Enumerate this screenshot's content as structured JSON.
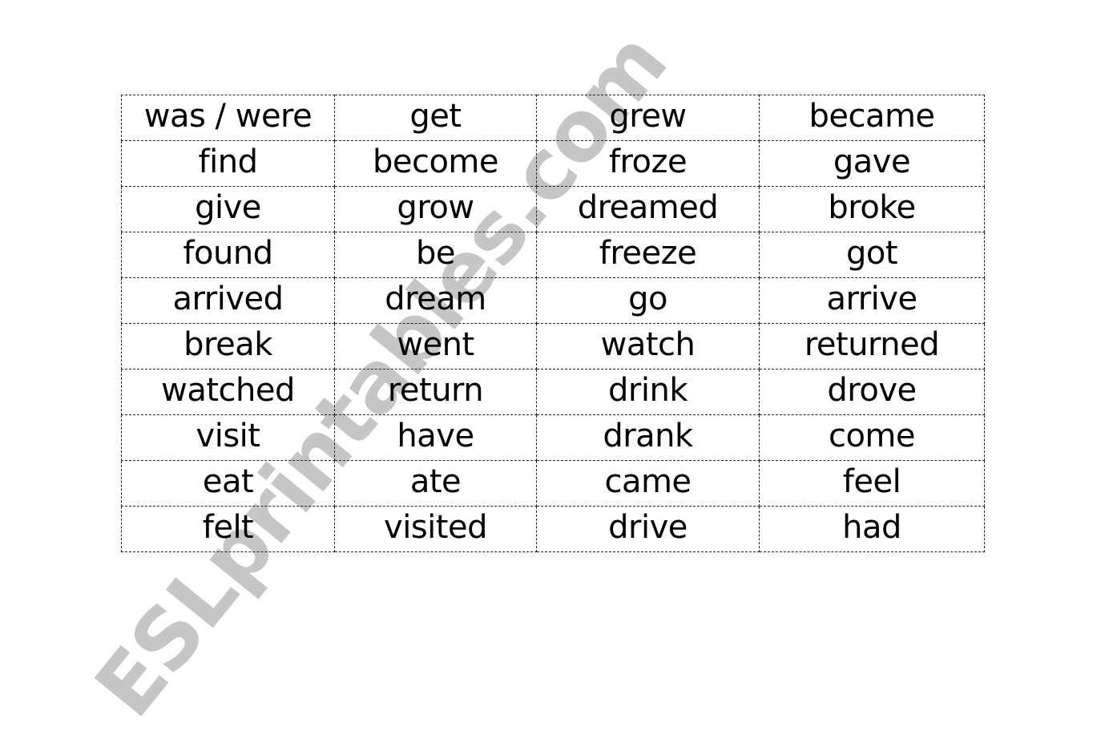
{
  "watermark": "ESLprintables.com",
  "table": {
    "rows": [
      [
        "was / were",
        "get",
        "grew",
        "became"
      ],
      [
        "find",
        "become",
        "froze",
        "gave"
      ],
      [
        "give",
        "grow",
        "dreamed",
        "broke"
      ],
      [
        "found",
        "be",
        "freeze",
        "got"
      ],
      [
        "arrived",
        "dream",
        "go",
        "arrive"
      ],
      [
        "break",
        "went",
        "watch",
        "returned"
      ],
      [
        "watched",
        "return",
        "drink",
        "drove"
      ],
      [
        "visit",
        "have",
        "drank",
        "come"
      ],
      [
        "eat",
        "ate",
        "came",
        "feel"
      ],
      [
        "felt",
        "visited",
        "drive",
        "had"
      ]
    ]
  }
}
